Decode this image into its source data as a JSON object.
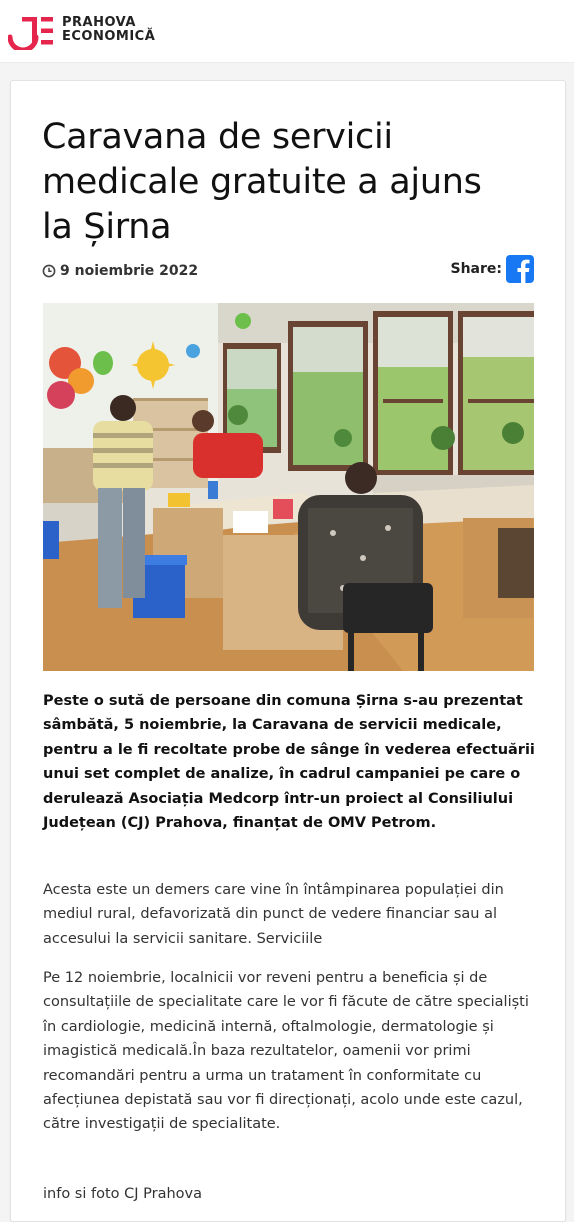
{
  "site": {
    "logo_line1": "PRAHOVA",
    "logo_line2": "ECONOMICĂ",
    "brand_color": "#e5254b"
  },
  "article": {
    "title": "Caravana de servicii medicale gratuite a ajuns la Șirna",
    "date": "9 noiembrie 2022",
    "share_label": "Share:",
    "share_icon": "facebook-icon",
    "date_icon": "clock-icon",
    "photo_alt": "Caravana de servicii medicale la Șirna",
    "lead": "Peste o sută de persoane din comuna Șirna s-au prezentat sâmbătă, 5 noiembrie, la Caravana de servicii medicale, pentru a le fi recoltate probe de sânge în vederea efectuării unui set complet de analize, în cadrul campaniei pe care o derulează Asociația Medcorp într-un proiect al Consiliului Județean (CJ) Prahova, finanțat de OMV Petrom.",
    "paragraph1": "Acesta este un demers care vine în întâmpinarea populației din mediul rural, defavorizată din punct de vedere financiar sau al accesului la servicii sanitare. Serviciile",
    "paragraph2": "Pe 12 noiembrie, localnicii vor reveni pentru a beneficia și de consultațiile de specialitate care le vor fi făcute de către specialiști în cardiologie, medicină internă, oftalmologie, dermatologie și imagistică medicală.În baza rezultatelor, oamenii vor primi recomandări pentru a urma un tratament în conformitate cu afecțiunea depistată sau vor fi direcționați, acolo unde este cazul, către investigații de specialitate.",
    "credit": "info si foto CJ Prahova"
  },
  "colors": {
    "facebook": "#1877f2",
    "text": "#111111",
    "body_text": "#333333"
  }
}
